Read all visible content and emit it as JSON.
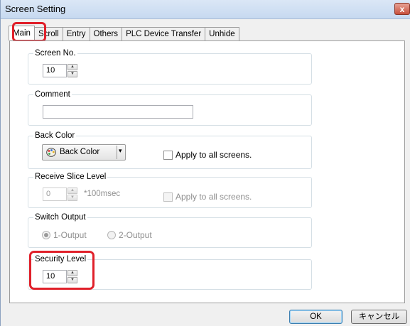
{
  "window": {
    "title": "Screen Setting",
    "close_glyph": "x"
  },
  "tabs": [
    {
      "label": "Main",
      "active": true
    },
    {
      "label": "Scroll"
    },
    {
      "label": "Entry"
    },
    {
      "label": "Others"
    },
    {
      "label": "PLC Device Transfer"
    },
    {
      "label": "Unhide"
    }
  ],
  "screen_no": {
    "label": "Screen No.",
    "value": "10"
  },
  "comment": {
    "label": "Comment",
    "value": ""
  },
  "back_color": {
    "label": "Back Color",
    "dropdown_label": "Back Color",
    "icon": "palette-icon",
    "apply_all_label": "Apply to all screens.",
    "apply_all_checked": false
  },
  "receive_slice": {
    "label": "Receive Slice Level",
    "value": "0",
    "unit": "*100msec",
    "apply_all_label": "Apply to all screens.",
    "enabled": false
  },
  "switch_output": {
    "label": "Switch Output",
    "options": [
      "1-Output",
      "2-Output"
    ],
    "selected": "1-Output",
    "enabled": false
  },
  "security_level": {
    "label": "Security Level",
    "value": "10"
  },
  "footer": {
    "ok_label": "OK",
    "cancel_label": "キャンセル"
  },
  "colors": {
    "highlight": "#e0202a",
    "title_gradient_top": "#dbe7f6",
    "close_button": "#c7503c"
  }
}
